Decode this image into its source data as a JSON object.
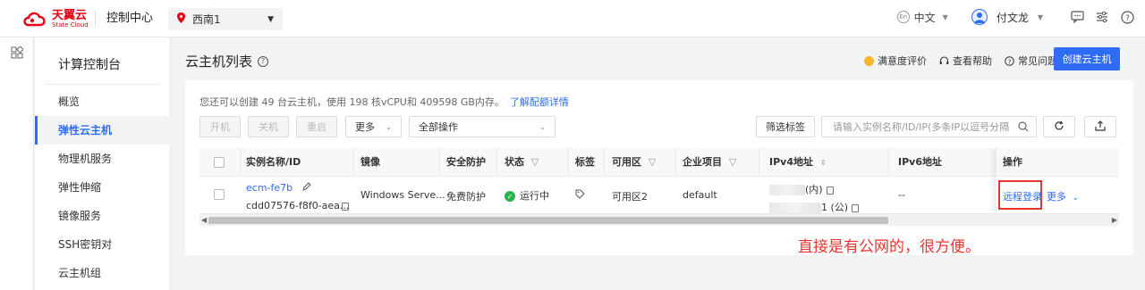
{
  "topbar": {
    "logo_cn": "天翼云",
    "logo_en": "State Cloud",
    "console_title": "控制中心",
    "region": "西南1",
    "language": "中文",
    "user_name": "付文龙"
  },
  "sidebar": {
    "title": "计算控制台",
    "items": [
      {
        "label": "概览"
      },
      {
        "label": "弹性云主机",
        "active": true
      },
      {
        "label": "物理机服务"
      },
      {
        "label": "弹性伸缩"
      },
      {
        "label": "镜像服务"
      },
      {
        "label": "SSH密钥对"
      },
      {
        "label": "云主机组"
      }
    ]
  },
  "page": {
    "title": "云主机列表",
    "links": [
      "满意度评价",
      "查看帮助",
      "常见问题"
    ],
    "create_button": "创建云主机"
  },
  "quota": {
    "text": "您还可以创建 49 台云主机，使用 198 核vCPU和 409598 GB内存。",
    "link": "了解配额详情"
  },
  "toolbar": {
    "power_on": "开机",
    "power_off": "关机",
    "restart": "重启",
    "more": "更多",
    "all_ops": "全部操作",
    "filter_tags": "筛选标签",
    "search_placeholder": "请输入实例名称/ID/IP(多条IP以逗号分隔"
  },
  "table": {
    "headers": [
      "实例名称/ID",
      "镜像",
      "安全防护",
      "状态",
      "标签",
      "可用区",
      "企业项目",
      "IPv4地址",
      "IPv6地址",
      "操作"
    ],
    "rows": [
      {
        "name": "ecm-fe7b",
        "id": "cdd07576-f8f0-aea...",
        "image": "Windows Serve...",
        "protection": "免费防护",
        "status": "运行中",
        "zone": "可用区2",
        "project": "default",
        "ipv4_internal_suffix": "(内)",
        "ipv4_public_suffix": "1 (公)",
        "ipv6": "--",
        "op_login": "远程登录",
        "op_more": "更多"
      }
    ]
  },
  "annotation": "直接是有公网的，很方便。",
  "colors": {
    "accent": "#2f6cf6",
    "brand": "#e60012",
    "status_running": "#2bb24c",
    "annotation": "#e8352f"
  }
}
